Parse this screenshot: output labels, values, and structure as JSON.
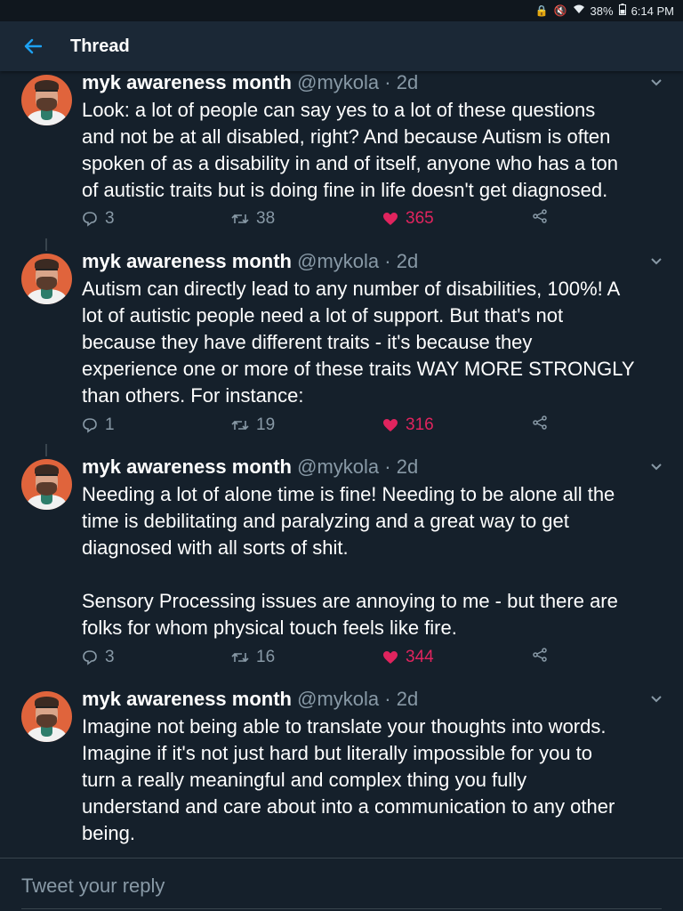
{
  "status_bar": {
    "battery": "38%",
    "time": "6:14 PM"
  },
  "app_bar": {
    "title": "Thread"
  },
  "tweets": [
    {
      "name": "myk awareness month",
      "handle": "@mykola",
      "separator": " · ",
      "age": "2d",
      "text": "Look: a lot of people can say yes to a lot of these questions\nand not be at all disabled, right? And because Autism is often\nspoken of as a disability in and of itself, anyone who has a ton\nof autistic traits but is doing fine in life doesn't get diagnosed.",
      "replies": "3",
      "retweets": "38",
      "likes": "365"
    },
    {
      "name": "myk awareness month",
      "handle": "@mykola",
      "separator": " · ",
      "age": "2d",
      "text": "Autism can directly lead to any number of disabilities, 100%! A\nlot of autistic people need a lot of support. But that's not\nbecause they have different traits - it's because they\nexperience one or more of these traits WAY MORE STRONGLY\nthan others. For instance:",
      "replies": "1",
      "retweets": "19",
      "likes": "316"
    },
    {
      "name": "myk awareness month",
      "handle": "@mykola",
      "separator": " · ",
      "age": "2d",
      "text": "Needing a lot of alone time is fine! Needing to be alone all the\ntime is debilitating and paralyzing and a great way to get\ndiagnosed with all sorts of shit.\n\nSensory Processing issues are annoying to me - but there are\nfolks for whom physical touch feels like fire.",
      "replies": "3",
      "retweets": "16",
      "likes": "344"
    },
    {
      "name": "myk awareness month",
      "handle": "@mykola",
      "separator": " · ",
      "age": "2d",
      "text": "Imagine not being able to translate your thoughts into words.\nImagine if it's not just hard but literally impossible for you to\nturn a really meaningful and complex thing you fully\nunderstand and care about into a communication to any other\nbeing."
    }
  ],
  "reply_bar": {
    "placeholder": "Tweet your reply"
  },
  "colors": {
    "accent": "#1da1f2",
    "like": "#e0245e",
    "background": "#15202b",
    "muted": "#8899a6"
  }
}
